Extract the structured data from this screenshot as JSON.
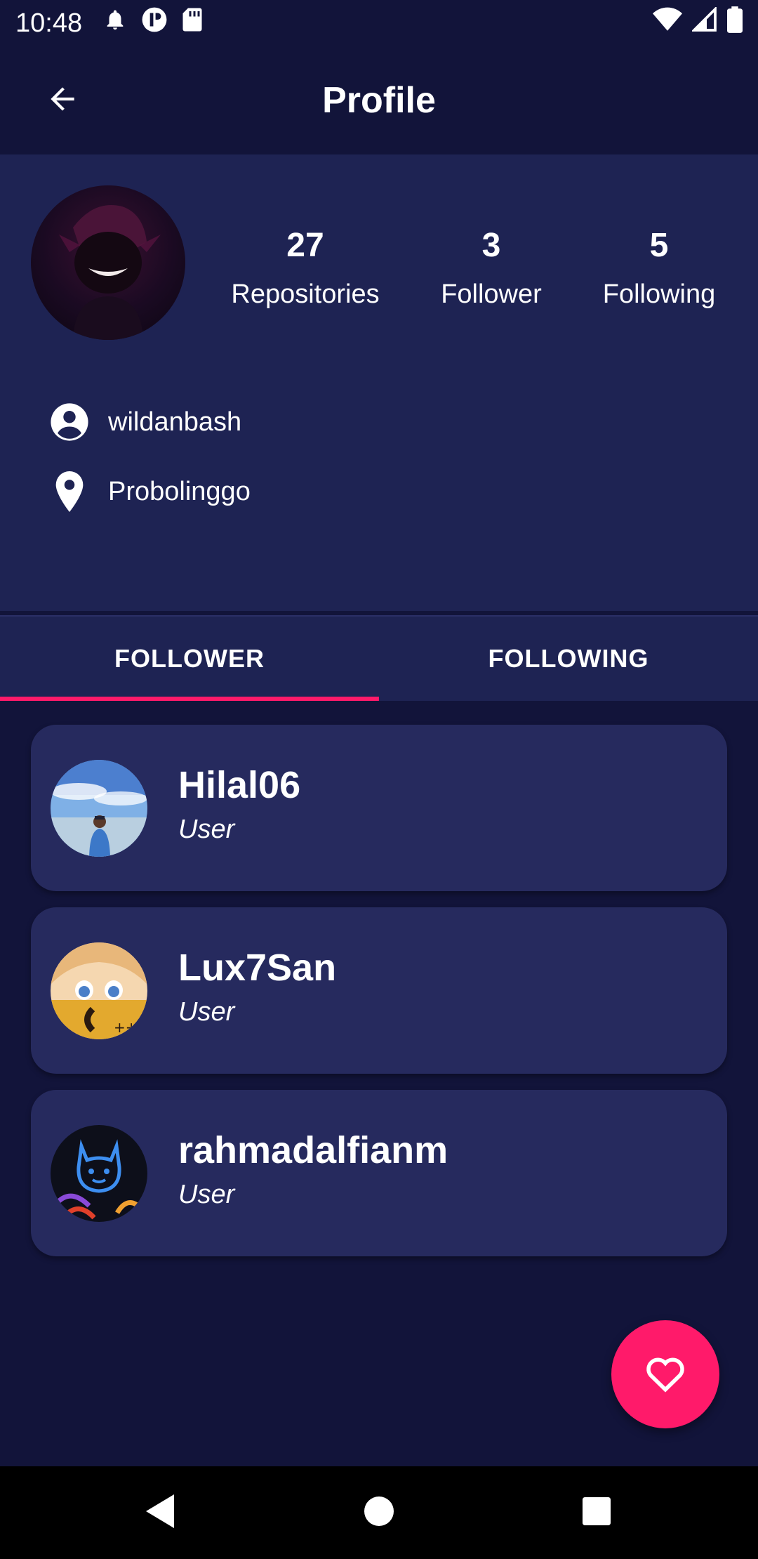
{
  "status_bar": {
    "time": "10:48",
    "icons_left": [
      "bell-icon",
      "app-icon",
      "sd-card-icon"
    ],
    "icons_right": [
      "wifi-icon",
      "signal-icon",
      "battery-icon"
    ]
  },
  "app_bar": {
    "title": "Profile",
    "back_icon": "arrow-back-icon"
  },
  "profile": {
    "repositories_count": "27",
    "repositories_label": "Repositories",
    "follower_count": "3",
    "follower_label": "Follower",
    "following_count": "5",
    "following_label": "Following",
    "username": "wildanbash",
    "location": "Probolinggo"
  },
  "tabs": [
    {
      "label": "FOLLOWER",
      "active": true
    },
    {
      "label": "FOLLOWING",
      "active": false
    }
  ],
  "users": [
    {
      "name": "Hilal06",
      "role": "User"
    },
    {
      "name": "Lux7San",
      "role": "User"
    },
    {
      "name": "rahmadalfianm",
      "role": "User"
    }
  ],
  "fab": {
    "icon": "heart-outline-icon"
  },
  "colors": {
    "background": "#12143a",
    "surface": "#1e2353",
    "card": "#262a5e",
    "accent": "#ff1a6a"
  }
}
